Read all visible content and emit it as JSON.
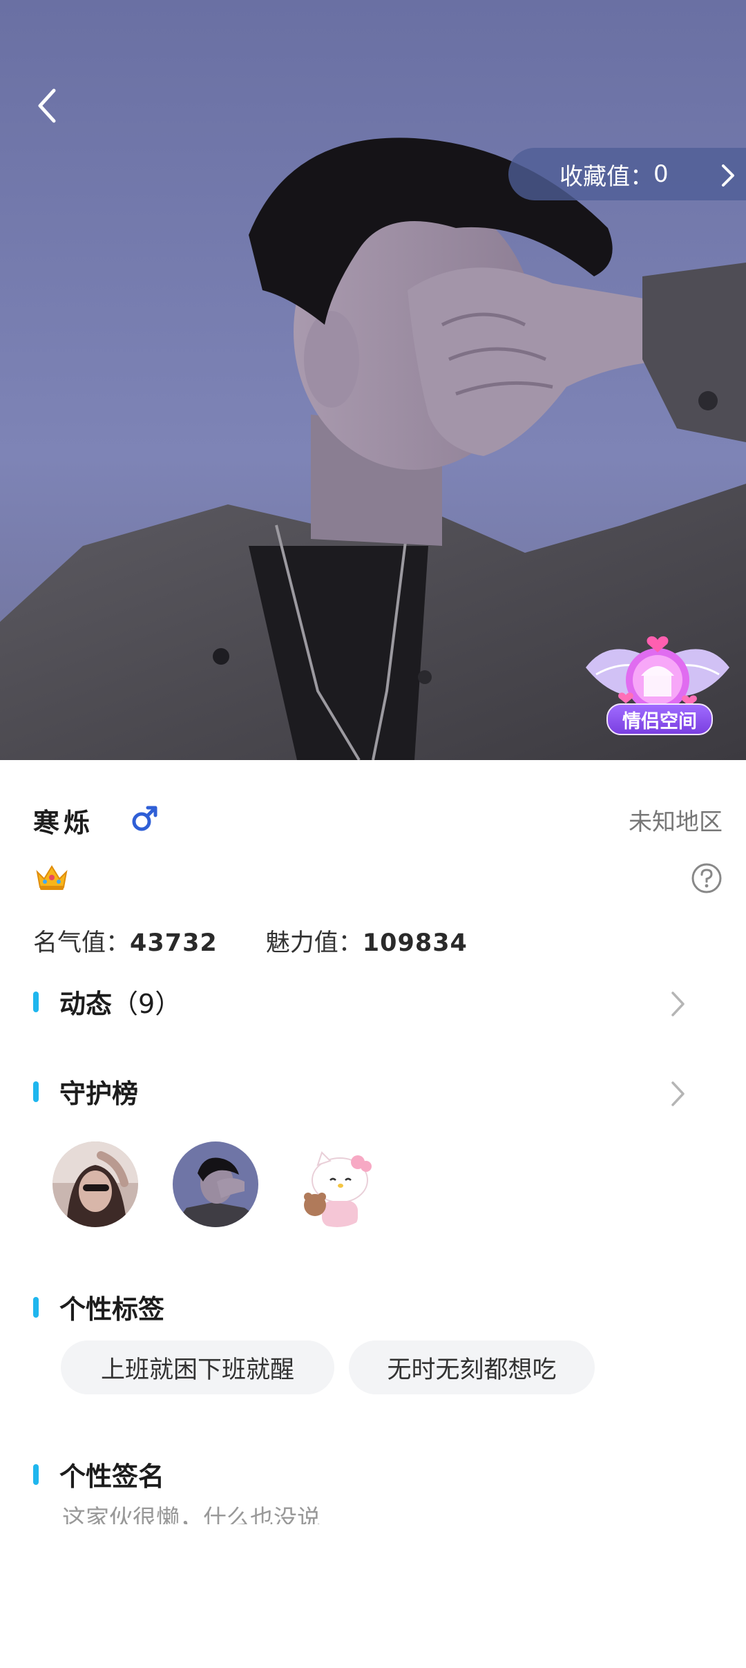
{
  "header": {
    "collect_label": "收藏值：",
    "collect_value": "0",
    "couple_space_label": "情侣空间"
  },
  "profile": {
    "name": "寒烁",
    "gender": "male",
    "region": "未知地区",
    "fame_label": "名气值：",
    "fame_value": "43732",
    "charm_label": "魅力值：",
    "charm_value": "109834"
  },
  "sections": {
    "moments": {
      "title": "动态",
      "count": "（9）"
    },
    "guardians": {
      "title": "守护榜",
      "avatars": [
        "avatar-woman",
        "avatar-man",
        "avatar-hello-kitty"
      ]
    },
    "tags": {
      "title": "个性标签",
      "items": [
        "上班就困下班就醒",
        "无时无刻都想吃"
      ]
    },
    "signature": {
      "title": "个性签名",
      "text": "这家伙很懒，什么也没说"
    }
  },
  "colors": {
    "accent_bar": "#1fb6ee",
    "gender_icon": "#2f5fd6",
    "couple_badge": "#8a4cf0"
  }
}
